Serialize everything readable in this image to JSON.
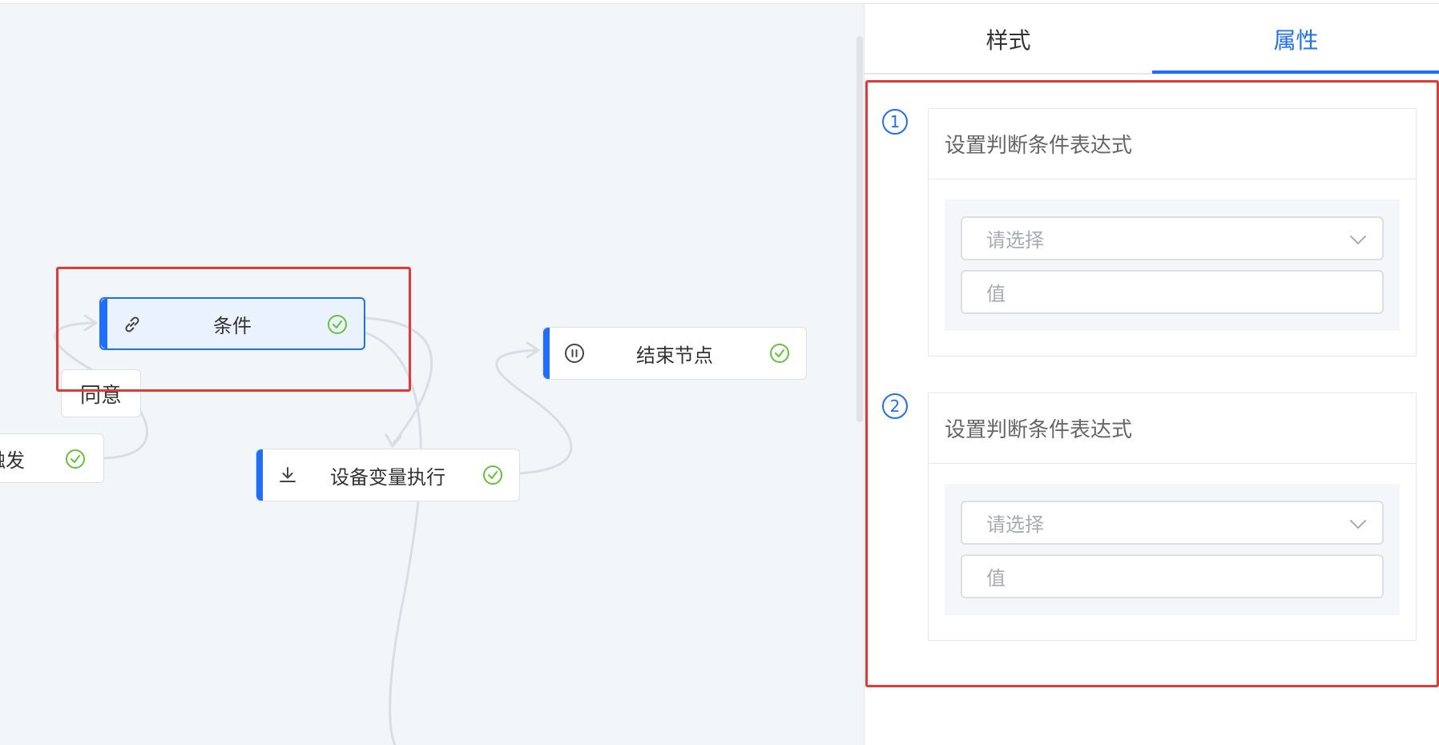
{
  "canvas": {
    "nodes": {
      "condition": {
        "label": "条件"
      },
      "end": {
        "label": "结束节点"
      },
      "device": {
        "label": "设备变量执行"
      },
      "trigger": {
        "label": "触发"
      }
    },
    "edge_label": "同意"
  },
  "panel": {
    "tabs": [
      {
        "label": "样式",
        "active": false
      },
      {
        "label": "属性",
        "active": true
      }
    ],
    "conditions": [
      {
        "index": "1",
        "title": "设置判断条件表达式",
        "select_placeholder": "请选择",
        "value_placeholder": "值"
      },
      {
        "index": "2",
        "title": "设置判断条件表达式",
        "select_placeholder": "请选择",
        "value_placeholder": "值"
      }
    ]
  },
  "colors": {
    "accent": "#1e6fff",
    "highlight": "#e53935",
    "success": "#67c23a",
    "canvas_bg": "#f3f6f9"
  }
}
